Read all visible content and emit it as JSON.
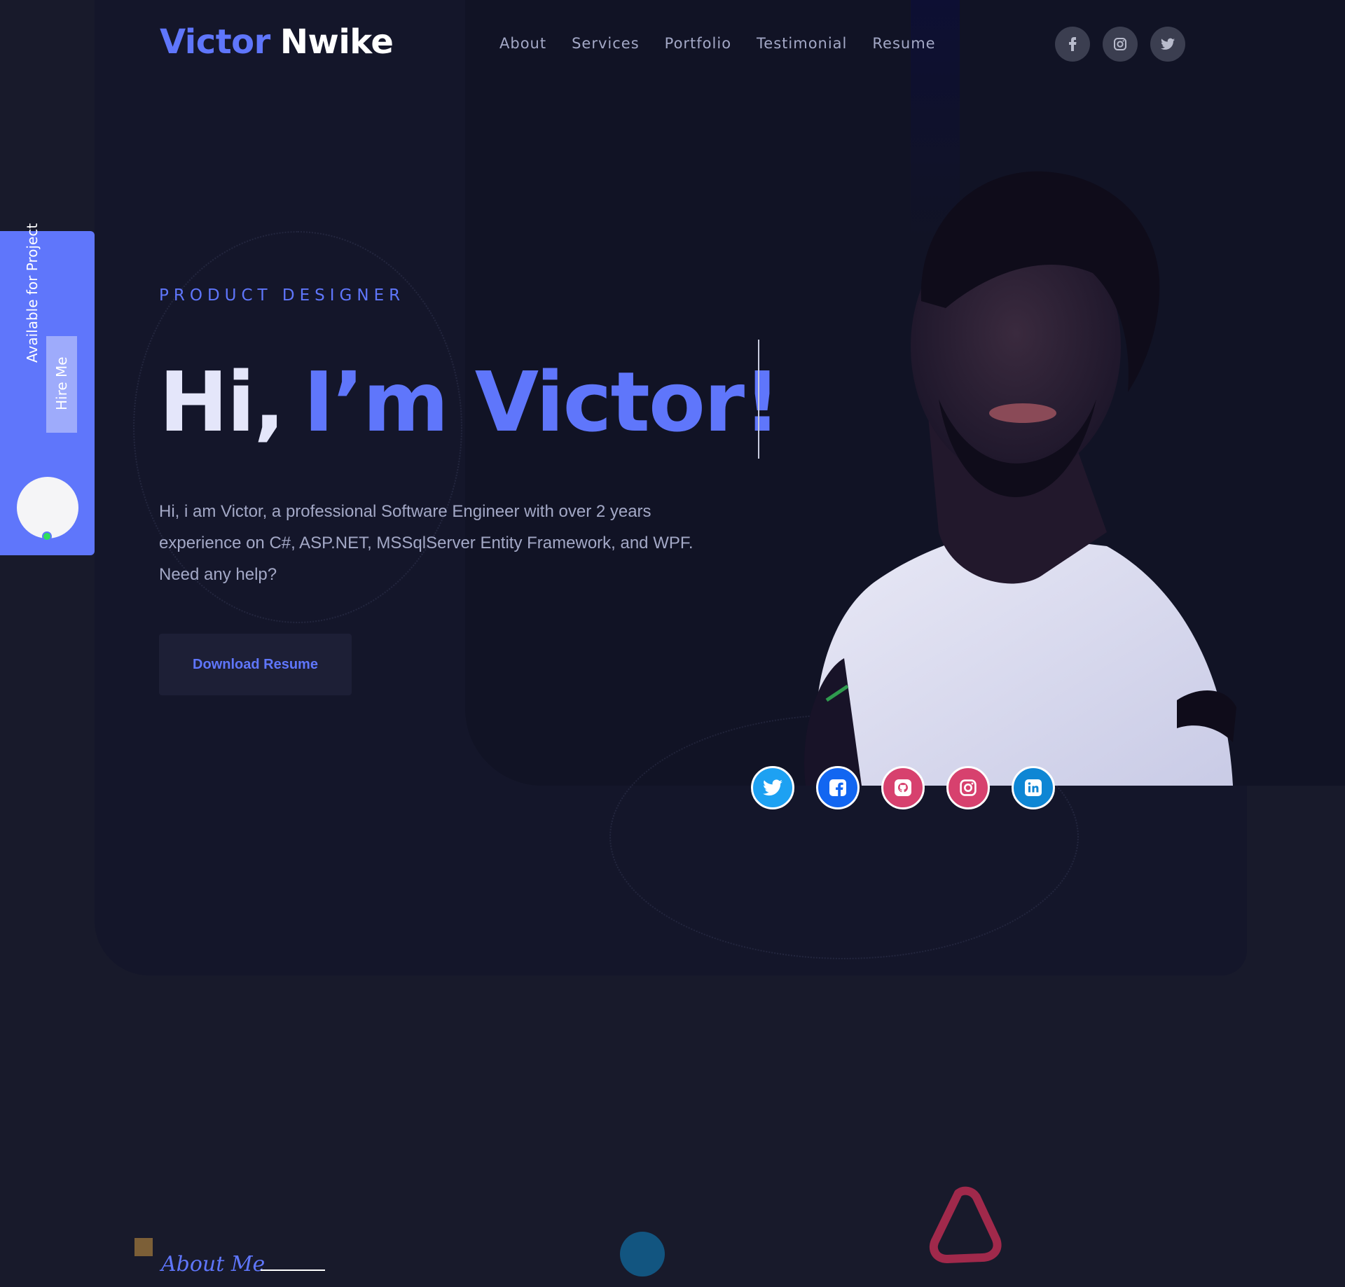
{
  "brand": {
    "first": "Victor",
    "last": "Nwike"
  },
  "nav": {
    "items": [
      {
        "label": "About"
      },
      {
        "label": "Services"
      },
      {
        "label": "Portfolio"
      },
      {
        "label": "Testimonial"
      },
      {
        "label": "Resume"
      }
    ]
  },
  "header_social": [
    "facebook-icon",
    "instagram-icon",
    "twitter-icon"
  ],
  "hire_panel": {
    "available_text": "Available for Project",
    "hire_label": "Hire Me"
  },
  "hero": {
    "eyebrow": "PRODUCT DESIGNER",
    "greeting": "Hi,",
    "name_text": "I’m Victor!",
    "intro": "Hi, i am Victor, a professional Software Engineer with over 2 years experience on C#, ASP.NET, MSSqlServer Entity Framework, and WPF. Need any help?",
    "download_label": "Download Resume"
  },
  "social_circles": [
    {
      "icon": "twitter-icon",
      "color": "#1da1f2"
    },
    {
      "icon": "facebook-icon",
      "color": "#1266f1"
    },
    {
      "icon": "github-icon",
      "color": "#d7416e"
    },
    {
      "icon": "instagram-icon",
      "color": "#d7416e"
    },
    {
      "icon": "linkedin-icon",
      "color": "#0e86d4"
    }
  ],
  "about": {
    "title": "About Me"
  },
  "colors": {
    "accent": "#5f76fb",
    "background": "#181a2b",
    "card": "#14162a",
    "online": "#2fe05a"
  }
}
